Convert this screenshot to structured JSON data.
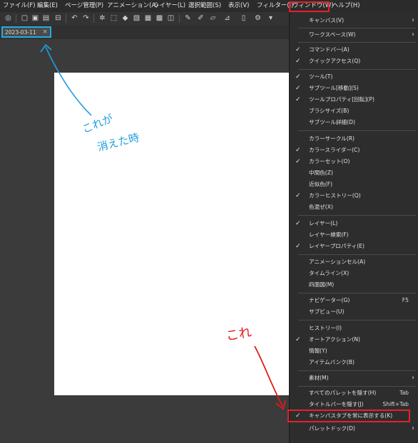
{
  "menubar": {
    "items": [
      "ファイル(F)",
      "編集(E)",
      "ページ管理(P)",
      "アニメーション(A)",
      "レイヤー(L)",
      "選択範囲(S)",
      "表示(V)",
      "フィルター(I)",
      "ウィンドウ(W)",
      "ヘルプ(H)"
    ]
  },
  "toolbar": {
    "icons": [
      "app-icon",
      "new-file-icon",
      "open-file-icon",
      "save-icon",
      "export-icon",
      "undo-icon",
      "redo-icon",
      "transform-icon",
      "selection-icon",
      "fill-icon",
      "erase-icon",
      "brush-icon",
      "pen-icon",
      "bucket-icon",
      "ruler-icon",
      "settings-icon"
    ]
  },
  "tab": {
    "label": "2023-03-11",
    "close": "×"
  },
  "annotations": {
    "left_note_line1": "これが",
    "left_note_line2": "消えた時",
    "right_note": "これ",
    "colors": {
      "blue": "#1e9fe0",
      "red": "#e01a1a"
    }
  },
  "window_menu": {
    "items": [
      {
        "label": "キャンバス(V)",
        "checked": false,
        "submenu": true,
        "shortcut": ""
      },
      {
        "label": "ワークスペース(W)",
        "checked": false,
        "submenu": true,
        "shortcut": ""
      },
      {
        "label": "コマンドバー(A)",
        "checked": true,
        "submenu": false,
        "shortcut": ""
      },
      {
        "label": "クイックアクセス(Q)",
        "checked": true,
        "submenu": false,
        "shortcut": ""
      },
      {
        "label": "ツール(T)",
        "checked": true,
        "submenu": false,
        "shortcut": ""
      },
      {
        "label": "サブツール[移動](S)",
        "checked": true,
        "submenu": false,
        "shortcut": ""
      },
      {
        "label": "ツールプロパティ[回転](P)",
        "checked": true,
        "submenu": false,
        "shortcut": ""
      },
      {
        "label": "ブラシサイズ(B)",
        "checked": false,
        "submenu": false,
        "shortcut": ""
      },
      {
        "label": "サブツール詳細(D)",
        "checked": false,
        "submenu": false,
        "shortcut": ""
      },
      {
        "label": "カラーサークル(R)",
        "checked": false,
        "submenu": false,
        "shortcut": ""
      },
      {
        "label": "カラースライダー(C)",
        "checked": true,
        "submenu": false,
        "shortcut": ""
      },
      {
        "label": "カラーセット(O)",
        "checked": true,
        "submenu": false,
        "shortcut": ""
      },
      {
        "label": "中間色(Z)",
        "checked": false,
        "submenu": false,
        "shortcut": ""
      },
      {
        "label": "近似色(F)",
        "checked": false,
        "submenu": false,
        "shortcut": ""
      },
      {
        "label": "カラーヒストリー(Q)",
        "checked": true,
        "submenu": false,
        "shortcut": ""
      },
      {
        "label": "色混ぜ(X)",
        "checked": false,
        "submenu": false,
        "shortcut": ""
      },
      {
        "label": "レイヤー(L)",
        "checked": true,
        "submenu": false,
        "shortcut": ""
      },
      {
        "label": "レイヤー検索(F)",
        "checked": false,
        "submenu": false,
        "shortcut": ""
      },
      {
        "label": "レイヤープロパティ(E)",
        "checked": true,
        "submenu": false,
        "shortcut": ""
      },
      {
        "label": "アニメーションセル(A)",
        "checked": false,
        "submenu": false,
        "shortcut": ""
      },
      {
        "label": "タイムライン(X)",
        "checked": false,
        "submenu": false,
        "shortcut": ""
      },
      {
        "label": "四面図(M)",
        "checked": false,
        "submenu": false,
        "shortcut": ""
      },
      {
        "label": "ナビゲーター(G)",
        "checked": false,
        "submenu": false,
        "shortcut": "F5"
      },
      {
        "label": "サブビュー(U)",
        "checked": false,
        "submenu": false,
        "shortcut": ""
      },
      {
        "label": "ヒストリー(I)",
        "checked": false,
        "submenu": false,
        "shortcut": ""
      },
      {
        "label": "オートアクション(N)",
        "checked": true,
        "submenu": false,
        "shortcut": ""
      },
      {
        "label": "情報(Y)",
        "checked": false,
        "submenu": false,
        "shortcut": ""
      },
      {
        "label": "アイテムバンク(B)",
        "checked": false,
        "submenu": false,
        "shortcut": ""
      },
      {
        "label": "素材(M)",
        "checked": false,
        "submenu": true,
        "shortcut": ""
      },
      {
        "label": "すべてのパレットを隠す(H)",
        "checked": false,
        "submenu": false,
        "shortcut": "Tab"
      },
      {
        "label": "タイトルバーを隠す(J)",
        "checked": false,
        "submenu": false,
        "shortcut": "Shift+Tab"
      },
      {
        "label": "キャンバスタブを常に表示する(K)",
        "checked": true,
        "submenu": false,
        "shortcut": ""
      },
      {
        "label": "パレットドック(D)",
        "checked": false,
        "submenu": true,
        "shortcut": ""
      }
    ]
  }
}
